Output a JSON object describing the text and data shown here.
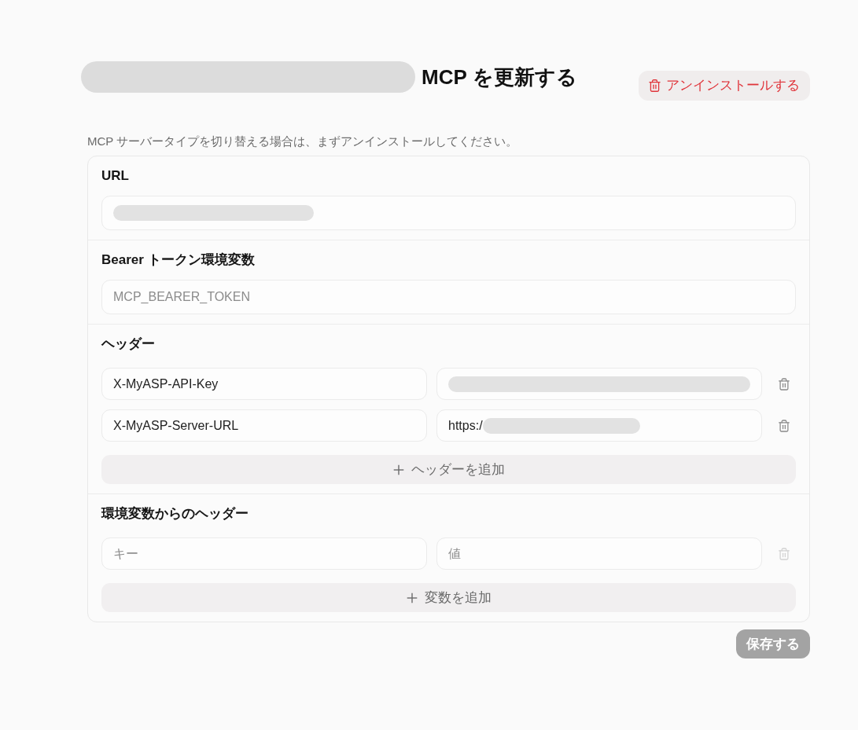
{
  "header": {
    "title_prefix_redacted": true,
    "title": "MCP を更新する",
    "uninstall_button": "アンインストールする"
  },
  "notice": "MCP サーバータイプを切り替える場合は、まずアンインストールしてください。",
  "sections": [
    {
      "kind": "field",
      "label": "URL",
      "field": {
        "redacted": true
      }
    },
    {
      "kind": "field",
      "label": "Bearer トークン環境変数",
      "field": {
        "placeholder": "MCP_BEARER_TOKEN"
      }
    },
    {
      "kind": "pairs",
      "label": "ヘッダー",
      "rows": [
        {
          "key": {
            "value": "X-MyASP-API-Key"
          },
          "value": {
            "redacted": true
          },
          "delete_disabled": false
        },
        {
          "key": {
            "value": "X-MyASP-Server-URL"
          },
          "value": {
            "value": "https:/",
            "redacted": true
          },
          "delete_disabled": false
        }
      ],
      "add_button": "ヘッダーを追加"
    },
    {
      "kind": "pairs",
      "label": "環境変数からのヘッダー",
      "rows": [
        {
          "key": {
            "placeholder": "キー"
          },
          "value": {
            "placeholder": "値"
          },
          "delete_disabled": true
        }
      ],
      "add_button": "変数を追加"
    }
  ],
  "save_button": {
    "label": "保存する",
    "disabled": true
  }
}
